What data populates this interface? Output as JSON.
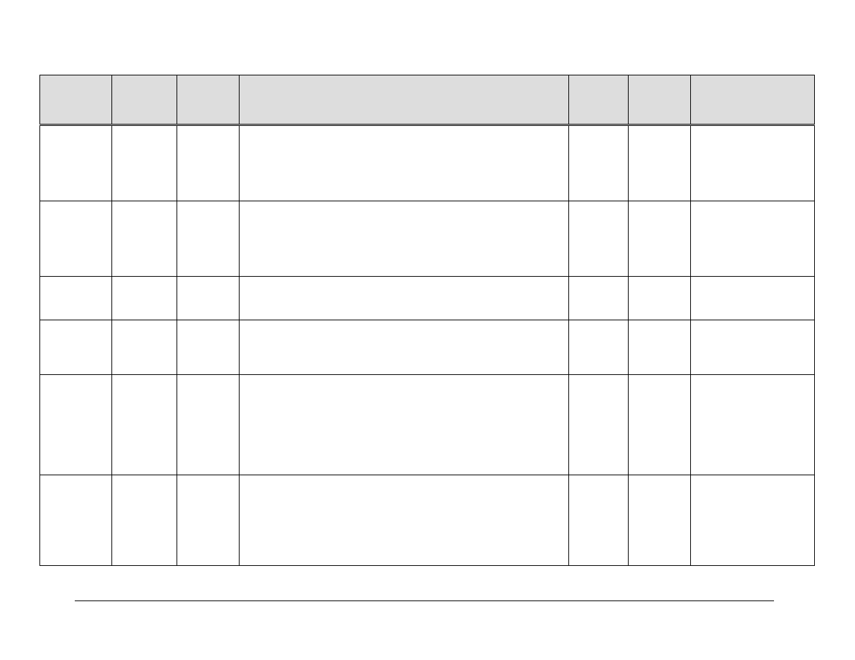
{
  "table": {
    "headers": [
      "",
      "",
      "",
      "",
      "",
      "",
      ""
    ],
    "rows": [
      [
        "",
        "",
        "",
        "",
        "",
        "",
        ""
      ],
      [
        "",
        "",
        "",
        "",
        "",
        "",
        ""
      ],
      [
        "",
        "",
        "",
        "",
        "",
        "",
        ""
      ],
      [
        "",
        "",
        "",
        "",
        "",
        "",
        ""
      ],
      [
        "",
        "",
        "",
        "",
        "",
        "",
        ""
      ],
      [
        "",
        "",
        "",
        "",
        "",
        "",
        ""
      ]
    ]
  }
}
